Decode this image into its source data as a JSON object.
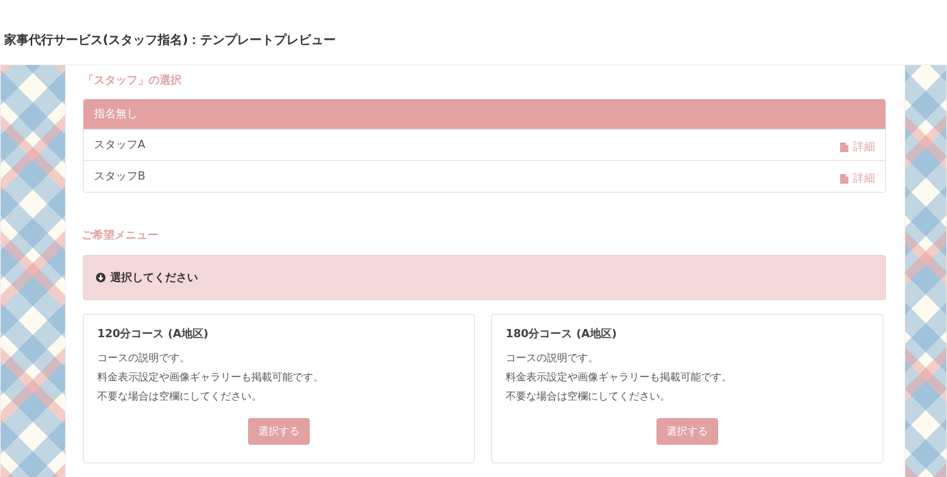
{
  "header": {
    "title": "家事代行サービス(スタッフ指名)：テンプレートプレビュー"
  },
  "staff_section": {
    "heading": "「スタッフ」の選択",
    "items": [
      {
        "name": "指名無し",
        "selected": true
      },
      {
        "name": "スタッフA",
        "selected": false,
        "detail": "詳細"
      },
      {
        "name": "スタッフB",
        "selected": false,
        "detail": "詳細"
      }
    ]
  },
  "menu_section": {
    "heading": "ご希望メニュー",
    "prompt": "選択してください",
    "courses": [
      {
        "title": "120分コース (A地区)",
        "description": [
          "コースの説明です。",
          "料金表示設定や画像ギャラリーも掲載可能です。",
          "不要な場合は空欄にしてください。"
        ],
        "button": "選択する"
      },
      {
        "title": "180分コース (A地区)",
        "description": [
          "コースの説明です。",
          "料金表示設定や画像ギャラリーも掲載可能です。",
          "不要な場合は空欄にしてください。"
        ],
        "button": "選択する"
      }
    ]
  }
}
